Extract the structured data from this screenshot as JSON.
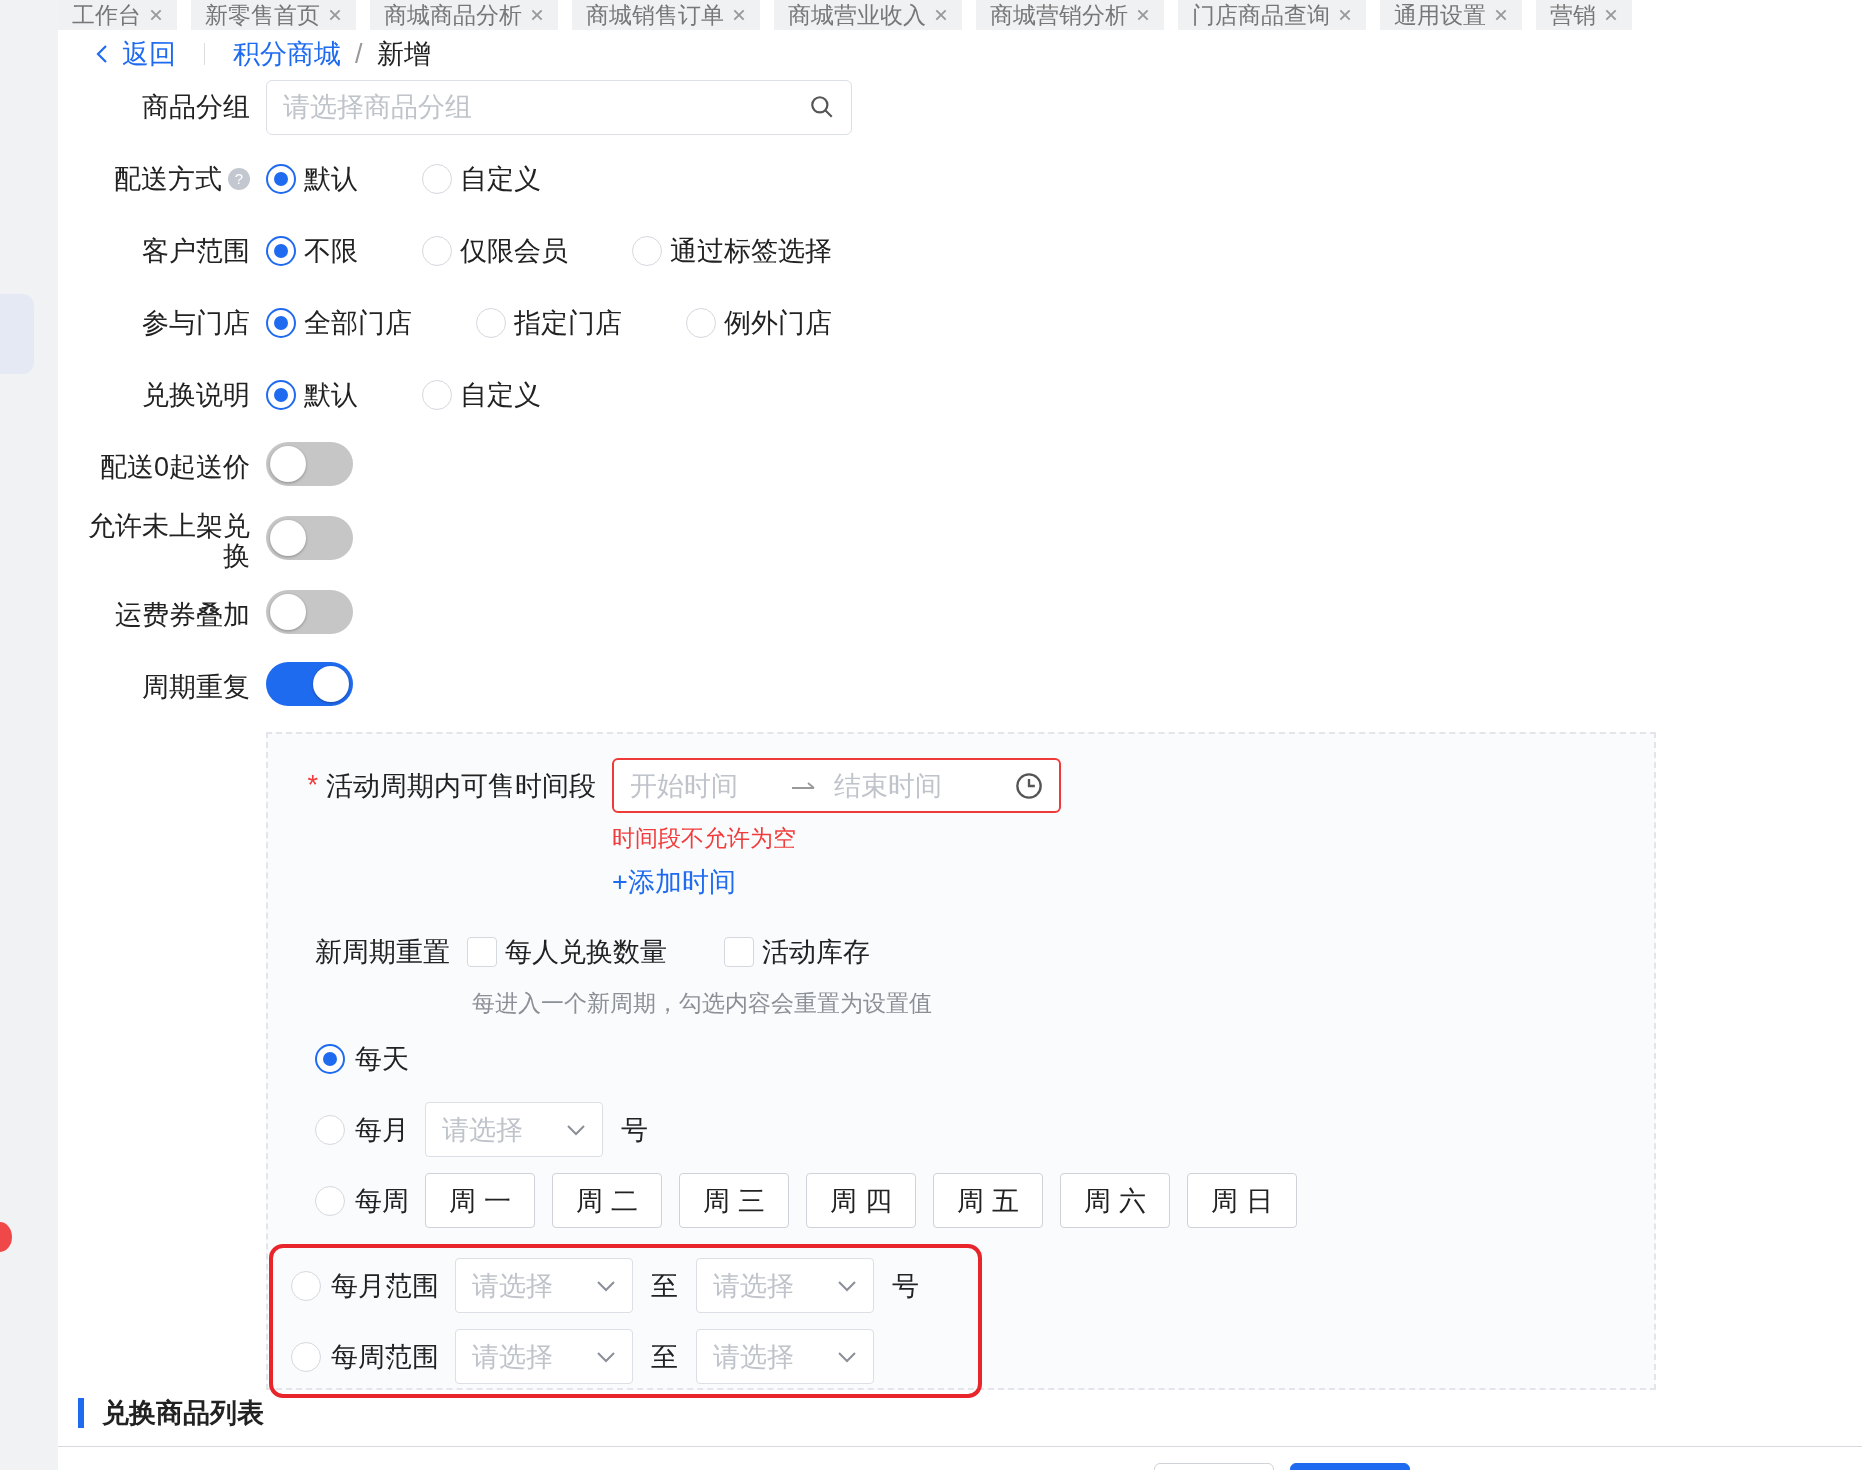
{
  "tabs": [
    {
      "label": "工作台"
    },
    {
      "label": "新零售首页"
    },
    {
      "label": "商城商品分析"
    },
    {
      "label": "商城销售订单"
    },
    {
      "label": "商城营业收入"
    },
    {
      "label": "商城营销分析"
    },
    {
      "label": "门店商品查询"
    },
    {
      "label": "通用设置"
    },
    {
      "label": "营销"
    }
  ],
  "breadcrumb": {
    "back": "返回",
    "items": [
      {
        "label": "积分商城",
        "link": true
      },
      {
        "label": "新增",
        "link": false
      }
    ],
    "separator": "/"
  },
  "form": [
    {
      "kind": "search-select",
      "label": "商品分组",
      "placeholder": "请选择商品分组"
    },
    {
      "kind": "radio",
      "label": "配送方式",
      "help": "?",
      "options": [
        {
          "label": "默认",
          "selected": true
        },
        {
          "label": "自定义",
          "selected": false
        }
      ]
    },
    {
      "kind": "radio",
      "label": "客户范围",
      "options": [
        {
          "label": "不限",
          "selected": true
        },
        {
          "label": "仅限会员",
          "selected": false
        },
        {
          "label": "通过标签选择",
          "selected": false
        }
      ]
    },
    {
      "kind": "radio",
      "label": "参与门店",
      "options": [
        {
          "label": "全部门店",
          "selected": true
        },
        {
          "label": "指定门店",
          "selected": false
        },
        {
          "label": "例外门店",
          "selected": false
        }
      ]
    },
    {
      "kind": "radio",
      "label": "兑换说明",
      "options": [
        {
          "label": "默认",
          "selected": true
        },
        {
          "label": "自定义",
          "selected": false
        }
      ]
    },
    {
      "kind": "switch",
      "label": "配送0起送价",
      "on": false
    },
    {
      "kind": "switch",
      "label": "允许未上架兑换",
      "on": false
    },
    {
      "kind": "switch",
      "label": "运费券叠加",
      "on": false
    },
    {
      "kind": "switch",
      "label": "周期重复",
      "on": true
    }
  ],
  "cycle_panel": {
    "time_range": {
      "required_mark": "*",
      "label": "活动周期内可售时间段",
      "start_placeholder": "开始时间",
      "end_placeholder": "结束时间",
      "error": "时间段不允许为空"
    },
    "add_time": "+添加时间",
    "reset": {
      "label": "新周期重置",
      "options": [
        {
          "label": "每人兑换数量",
          "checked": false
        },
        {
          "label": "活动库存",
          "checked": false
        }
      ],
      "hint": "每进入一个新周期，勾选内容会重置为设置值"
    },
    "frequencies": [
      {
        "kind": "plain",
        "label": "每天",
        "selected": true
      },
      {
        "kind": "select",
        "label": "每月",
        "selected": false,
        "placeholder": "请选择",
        "suffix": "号"
      },
      {
        "kind": "weekdays",
        "label": "每周",
        "selected": false,
        "days": [
          "周 一",
          "周 二",
          "周 三",
          "周 四",
          "周 五",
          "周 六",
          "周 日"
        ]
      }
    ],
    "highlighted_frequencies": [
      {
        "kind": "range",
        "label": "每月范围",
        "selected": false,
        "from_placeholder": "请选择",
        "to": "至",
        "to_placeholder": "请选择",
        "suffix": "号"
      },
      {
        "kind": "range",
        "label": "每周范围",
        "selected": false,
        "from_placeholder": "请选择",
        "to": "至",
        "to_placeholder": "请选择"
      }
    ]
  },
  "section_title": "兑换商品列表"
}
